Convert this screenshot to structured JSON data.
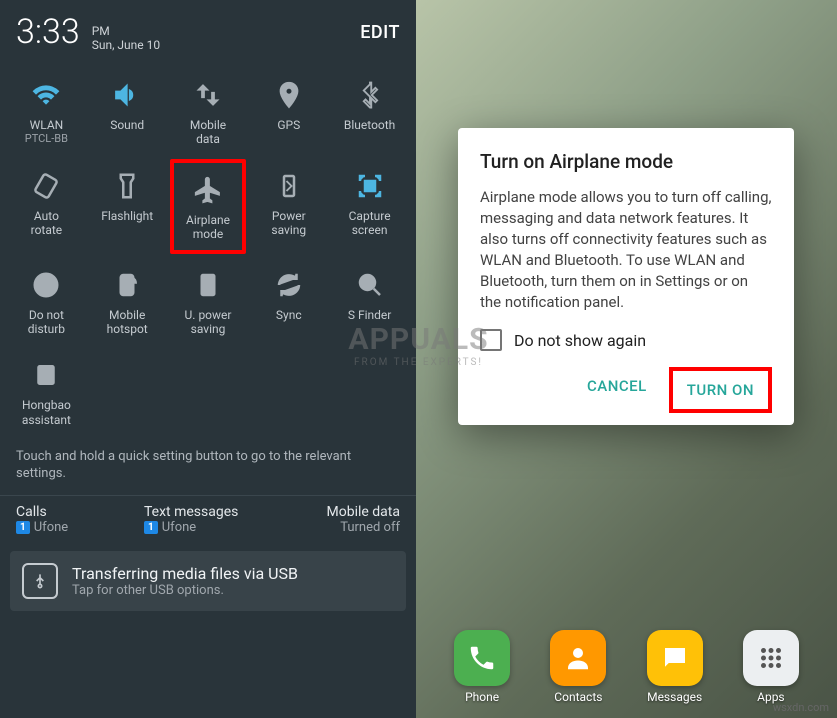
{
  "statusbar": {
    "time": "3:33",
    "ampm": "PM",
    "date": "Sun, June 10",
    "edit": "EDIT"
  },
  "tiles": [
    {
      "name": "wlan",
      "label": "WLAN",
      "sublabel": "PTCL-BB",
      "active": true
    },
    {
      "name": "sound",
      "label": "Sound",
      "sublabel": "",
      "active": true
    },
    {
      "name": "mobile-data",
      "label": "Mobile\ndata",
      "sublabel": "",
      "active": false
    },
    {
      "name": "gps",
      "label": "GPS",
      "sublabel": "",
      "active": false
    },
    {
      "name": "bluetooth",
      "label": "Bluetooth",
      "sublabel": "",
      "active": false
    },
    {
      "name": "auto-rotate",
      "label": "Auto\nrotate",
      "sublabel": "",
      "active": false
    },
    {
      "name": "flashlight",
      "label": "Flashlight",
      "sublabel": "",
      "active": false
    },
    {
      "name": "airplane-mode",
      "label": "Airplane\nmode",
      "sublabel": "",
      "active": false,
      "highlight": true
    },
    {
      "name": "power-saving",
      "label": "Power\nsaving",
      "sublabel": "",
      "active": false
    },
    {
      "name": "capture-screen",
      "label": "Capture\nscreen",
      "sublabel": "",
      "active": true
    },
    {
      "name": "do-not-disturb",
      "label": "Do not\ndisturb",
      "sublabel": "",
      "active": false
    },
    {
      "name": "mobile-hotspot",
      "label": "Mobile\nhotspot",
      "sublabel": "",
      "active": false
    },
    {
      "name": "u-power-saving",
      "label": "U. power\nsaving",
      "sublabel": "",
      "active": false
    },
    {
      "name": "sync",
      "label": "Sync",
      "sublabel": "",
      "active": false
    },
    {
      "name": "s-finder",
      "label": "S Finder",
      "sublabel": "",
      "active": false
    },
    {
      "name": "hongbao-assistant",
      "label": "Hongbao\nassistant",
      "sublabel": "",
      "active": false
    }
  ],
  "hint": "Touch and hold a quick setting button to go to the relevant settings.",
  "notifications": {
    "calls": {
      "title": "Calls",
      "count": "1",
      "sub": "Ufone"
    },
    "texts": {
      "title": "Text messages",
      "count": "1",
      "sub": "Ufone"
    },
    "mobiledata": {
      "title": "Mobile data",
      "sub": "Turned off"
    }
  },
  "usb": {
    "title": "Transferring media files via USB",
    "sub": "Tap for other USB options."
  },
  "dialog": {
    "title": "Turn on Airplane mode",
    "body": "Airplane mode allows you to turn off calling, messaging and data network features. It also turns off connectivity features such as WLAN and Bluetooth. To use WLAN and Bluetooth, turn them on in Settings or on the notification panel.",
    "checkbox_label": "Do not show again",
    "cancel": "CANCEL",
    "confirm": "TURN ON"
  },
  "dock": [
    {
      "name": "phone",
      "label": "Phone",
      "bg": "#4caf50"
    },
    {
      "name": "contacts",
      "label": "Contacts",
      "bg": "#ff9800"
    },
    {
      "name": "messages",
      "label": "Messages",
      "bg": "#ffc107"
    },
    {
      "name": "apps",
      "label": "Apps",
      "bg": "#eceff1"
    }
  ],
  "watermark": {
    "top": "APPUALS",
    "sub": "FROM THE EXPERTS!"
  },
  "credit": "wsxdn.com"
}
